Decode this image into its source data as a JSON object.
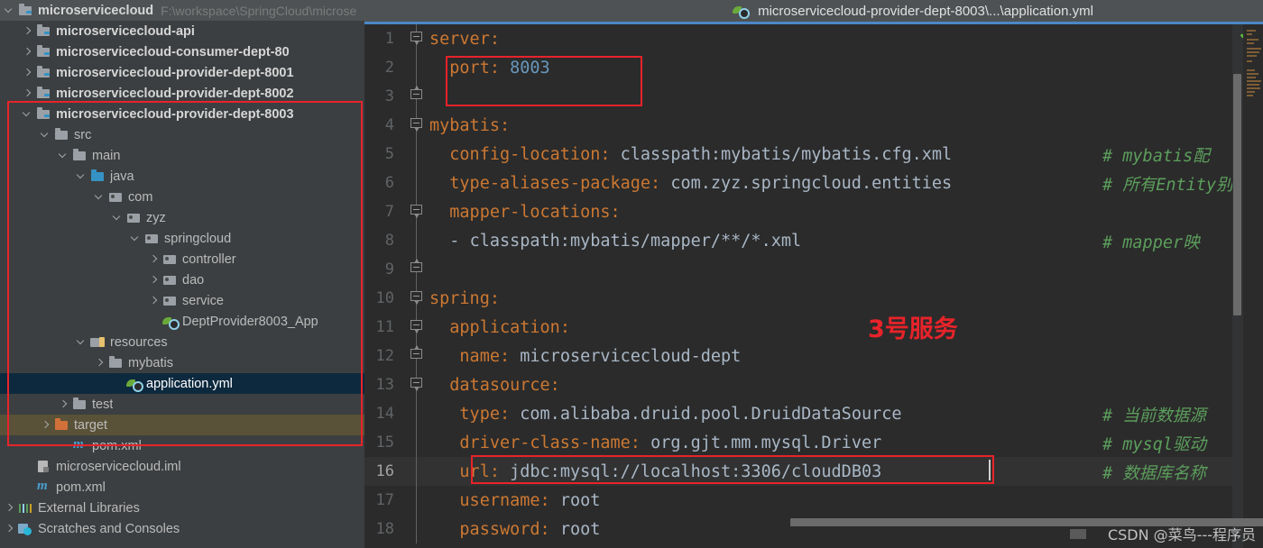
{
  "sidebar": {
    "rows": [
      {
        "indent": 0,
        "twist": "open",
        "icon": "mod",
        "label": "microservicecloud",
        "bold": true,
        "path": "F:\\workspace\\SpringCloud\\microse"
      },
      {
        "indent": 1,
        "twist": "closed",
        "icon": "mod",
        "label": "microservicecloud-api",
        "bold": true
      },
      {
        "indent": 1,
        "twist": "closed",
        "icon": "mod",
        "label": "microservicecloud-consumer-dept-80",
        "bold": true
      },
      {
        "indent": 1,
        "twist": "closed",
        "icon": "mod",
        "label": "microservicecloud-provider-dept-8001",
        "bold": true
      },
      {
        "indent": 1,
        "twist": "closed",
        "icon": "mod",
        "label": "microservicecloud-provider-dept-8002",
        "bold": true
      },
      {
        "indent": 1,
        "twist": "open",
        "icon": "mod",
        "label": "microservicecloud-provider-dept-8003",
        "bold": true
      },
      {
        "indent": 2,
        "twist": "open",
        "icon": "fold",
        "label": "src"
      },
      {
        "indent": 3,
        "twist": "open",
        "icon": "fold",
        "label": "main"
      },
      {
        "indent": 4,
        "twist": "open",
        "icon": "src",
        "label": "java"
      },
      {
        "indent": 5,
        "twist": "open",
        "icon": "pkg",
        "label": "com"
      },
      {
        "indent": 6,
        "twist": "open",
        "icon": "pkg",
        "label": "zyz"
      },
      {
        "indent": 7,
        "twist": "open",
        "icon": "pkg",
        "label": "springcloud"
      },
      {
        "indent": 8,
        "twist": "closed",
        "icon": "pkg",
        "label": "controller"
      },
      {
        "indent": 8,
        "twist": "closed",
        "icon": "pkg",
        "label": "dao"
      },
      {
        "indent": 8,
        "twist": "closed",
        "icon": "pkg",
        "label": "service"
      },
      {
        "indent": 8,
        "twist": "none",
        "icon": "spring",
        "label": "DeptProvider8003_App"
      },
      {
        "indent": 4,
        "twist": "open",
        "icon": "res",
        "label": "resources"
      },
      {
        "indent": 5,
        "twist": "closed",
        "icon": "fold",
        "label": "mybatis"
      },
      {
        "indent": 6,
        "twist": "none",
        "icon": "spring",
        "label": "application.yml",
        "selected": true
      },
      {
        "indent": 3,
        "twist": "closed",
        "icon": "fold",
        "label": "test"
      },
      {
        "indent": 2,
        "twist": "closed",
        "icon": "tgt",
        "label": "target",
        "target": true
      },
      {
        "indent": 3,
        "twist": "none",
        "icon": "mvn",
        "label": "pom.xml"
      },
      {
        "indent": 1,
        "twist": "none",
        "icon": "iml",
        "label": "microservicecloud.iml"
      },
      {
        "indent": 1,
        "twist": "none",
        "icon": "mvn",
        "label": "pom.xml"
      },
      {
        "indent": 0,
        "twist": "closed",
        "icon": "libs",
        "label": "External Libraries"
      },
      {
        "indent": 0,
        "twist": "closed",
        "icon": "scr",
        "label": "Scratches and Consoles"
      }
    ]
  },
  "editor": {
    "tab_title": "microservicecloud-provider-dept-8003\\...\\application.yml",
    "tab_icon": "spring-yaml-icon",
    "annotation": "3号服务",
    "inspection_status": "ok-check-icon",
    "current_line": 16,
    "lines": [
      {
        "n": 1,
        "fold": "down",
        "indent": 0,
        "parts": [
          {
            "t": "server",
            "c": "k"
          },
          {
            "t": ":",
            "c": "k"
          }
        ]
      },
      {
        "n": 2,
        "fold": "",
        "indent": 2,
        "parts": [
          {
            "t": "port",
            "c": "k"
          },
          {
            "t": ": ",
            "c": "k"
          },
          {
            "t": "8003",
            "c": "n"
          }
        ]
      },
      {
        "n": 3,
        "fold": "up",
        "indent": 0,
        "parts": []
      },
      {
        "n": 4,
        "fold": "down",
        "indent": 0,
        "parts": [
          {
            "t": "mybatis",
            "c": "k"
          },
          {
            "t": ":",
            "c": "k"
          }
        ]
      },
      {
        "n": 5,
        "fold": "",
        "indent": 2,
        "parts": [
          {
            "t": "config-location",
            "c": "k"
          },
          {
            "t": ": ",
            "c": "k"
          },
          {
            "t": "classpath:mybatis/mybatis.cfg.xml",
            "c": "v"
          }
        ],
        "comment": "# mybatis配"
      },
      {
        "n": 6,
        "fold": "",
        "indent": 2,
        "parts": [
          {
            "t": "type-aliases-package",
            "c": "k"
          },
          {
            "t": ": ",
            "c": "k"
          },
          {
            "t": "com.zyz.springcloud.entities",
            "c": "v"
          }
        ],
        "comment": "# 所有Entity别名"
      },
      {
        "n": 7,
        "fold": "down",
        "indent": 2,
        "parts": [
          {
            "t": "mapper-locations",
            "c": "k"
          },
          {
            "t": ":",
            "c": "k"
          }
        ]
      },
      {
        "n": 8,
        "fold": "",
        "indent": 2,
        "parts": [
          {
            "t": "- ",
            "c": "v"
          },
          {
            "t": "classpath:mybatis/mapper/**/*.xml",
            "c": "v"
          }
        ],
        "comment": "# mapper映"
      },
      {
        "n": 9,
        "fold": "up",
        "indent": 0,
        "parts": []
      },
      {
        "n": 10,
        "fold": "down",
        "indent": 0,
        "parts": [
          {
            "t": "spring",
            "c": "k"
          },
          {
            "t": ":",
            "c": "k"
          }
        ]
      },
      {
        "n": 11,
        "fold": "down",
        "indent": 2,
        "parts": [
          {
            "t": "application",
            "c": "k"
          },
          {
            "t": ":",
            "c": "k"
          }
        ]
      },
      {
        "n": 12,
        "fold": "up",
        "indent": 3,
        "parts": [
          {
            "t": "name",
            "c": "k"
          },
          {
            "t": ": ",
            "c": "k"
          },
          {
            "t": "microservicecloud-dept",
            "c": "v"
          }
        ]
      },
      {
        "n": 13,
        "fold": "down",
        "indent": 2,
        "parts": [
          {
            "t": "datasource",
            "c": "k"
          },
          {
            "t": ":",
            "c": "k"
          }
        ]
      },
      {
        "n": 14,
        "fold": "",
        "indent": 3,
        "parts": [
          {
            "t": "type",
            "c": "k"
          },
          {
            "t": ": ",
            "c": "k"
          },
          {
            "t": "com.alibaba.druid.pool.DruidDataSource",
            "c": "v"
          }
        ],
        "comment": "# 当前数据源"
      },
      {
        "n": 15,
        "fold": "",
        "indent": 3,
        "parts": [
          {
            "t": "driver-class-name",
            "c": "k"
          },
          {
            "t": ": ",
            "c": "k"
          },
          {
            "t": "org.gjt.mm.mysql.Driver",
            "c": "v"
          }
        ],
        "comment": "# mysql驱动"
      },
      {
        "n": 16,
        "fold": "",
        "indent": 3,
        "parts": [
          {
            "t": "url",
            "c": "k"
          },
          {
            "t": ": ",
            "c": "k"
          },
          {
            "t": "jdbc:mysql://localhost:3306/cloudDB03",
            "c": "v"
          }
        ],
        "comment": "# 数据库名称"
      },
      {
        "n": 17,
        "fold": "",
        "indent": 3,
        "parts": [
          {
            "t": "username",
            "c": "k"
          },
          {
            "t": ": ",
            "c": "k"
          },
          {
            "t": "root",
            "c": "v"
          }
        ]
      },
      {
        "n": 18,
        "fold": "",
        "indent": 3,
        "parts": [
          {
            "t": "password",
            "c": "k"
          },
          {
            "t": ": ",
            "c": "k"
          },
          {
            "t": "root",
            "c": "v"
          }
        ]
      }
    ]
  },
  "watermark": "CSDN @菜鸟---程序员",
  "colors": {
    "key": "#cc7832",
    "value": "#a9b7c6",
    "number": "#6897bb",
    "comment": "#5c9e5c",
    "annotation_red": "#e8232a",
    "selection": "#0d293e",
    "tab_accent": "#4a88c7"
  }
}
